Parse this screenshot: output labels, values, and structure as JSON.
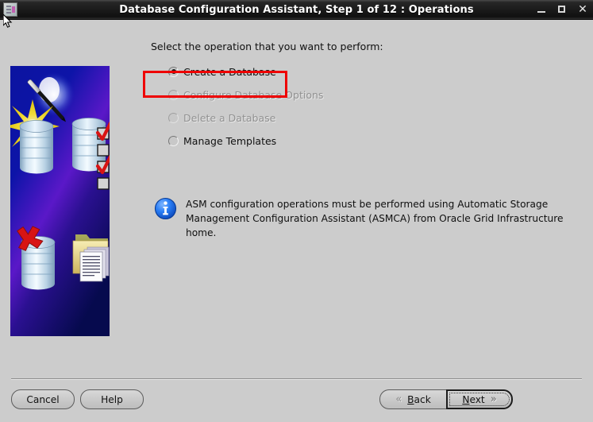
{
  "window": {
    "title": "Database Configuration Assistant, Step 1 of 12 : Operations",
    "icon": "app-icon",
    "controls": {
      "minimize": "_",
      "maximize": "□",
      "close": "✕"
    }
  },
  "main": {
    "prompt": "Select the operation that you want to perform:",
    "options": [
      {
        "label": "Create a Database",
        "selected": true,
        "enabled": true,
        "highlighted": true
      },
      {
        "label": "Configure Database Options",
        "selected": false,
        "enabled": false,
        "highlighted": false
      },
      {
        "label": "Delete a Database",
        "selected": false,
        "enabled": false,
        "highlighted": false
      },
      {
        "label": "Manage Templates",
        "selected": false,
        "enabled": true,
        "highlighted": false
      }
    ],
    "note": {
      "icon": "info-icon",
      "line1": "ASM configuration operations must be performed using Automatic Storage",
      "line2": "Management Configuration Assistant (ASMCA) from Oracle Grid Infrastructure home.",
      "text": "ASM configuration operations must be performed using Automatic Storage Management Configuration Assistant (ASMCA) from Oracle Grid Infrastructure home."
    },
    "artwork": {
      "name": "database-wizard-illustration",
      "description": "Magic wand with starburst over stacked database cylinders, a checklist, a red X on a database and a folder with documents"
    }
  },
  "footer": {
    "cancel": "Cancel",
    "help": "Help",
    "back": {
      "mnemonic": "B",
      "rest": "ack",
      "chevron": "«",
      "enabled": false
    },
    "next": {
      "mnemonic": "N",
      "rest": "ext",
      "chevron": "»",
      "focused": true
    }
  },
  "colors": {
    "background": "#cccccc",
    "titlebar": "#1b1b1b",
    "highlight": "#ee0000",
    "info_blue": "#1b6ff0",
    "art_blue": "#0b1c8c"
  }
}
